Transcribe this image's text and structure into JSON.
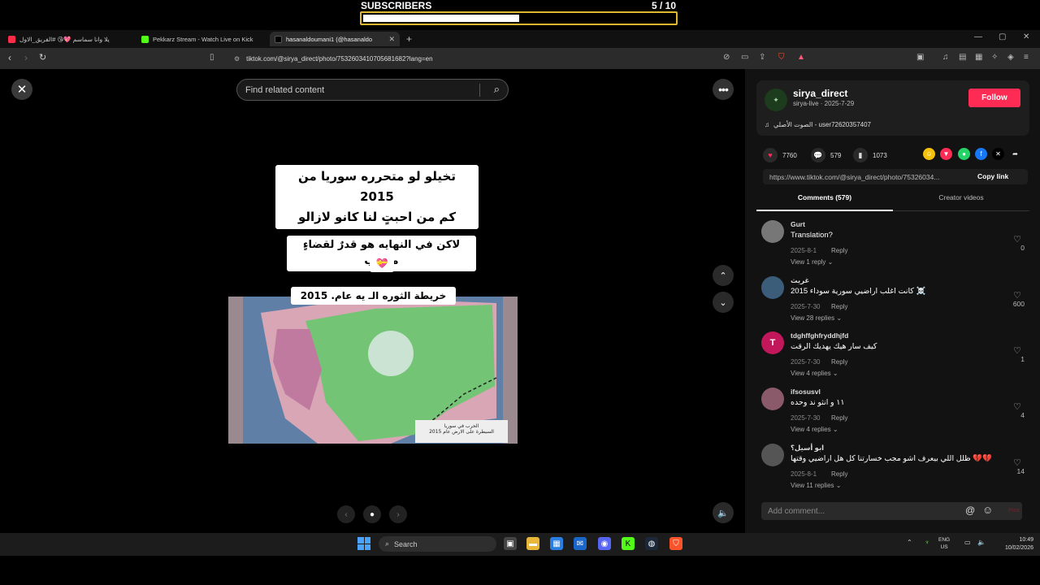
{
  "overlay": {
    "label": "SUBSCRIBERS",
    "count": "5  / 10",
    "progress": 0.5
  },
  "browser": {
    "tabs": [
      {
        "label": "يلا وانا سماسم 💖😘 #الفريق_الاول",
        "color": "#ff2b4a"
      },
      {
        "label": "Pekkarz Stream - Watch Live on Kick",
        "color": "#53fc18"
      },
      {
        "label": "hasanaldoumani1 (@hasanaldo",
        "color": "#222222"
      }
    ],
    "url": "tiktok.com/@sirya_direct/photo/7532603410705681682?lang=en"
  },
  "viewer": {
    "search_placeholder": "Find related content",
    "caption1_line1": "تخيلو لو متحرره سوريا من 2015",
    "caption1_line2": "كم من احبتٍ لنا كانو لازالو",
    "caption2": "لاكن في النهايه هو قدرٌ لقضاءٍ مكتوب",
    "caption2_emoji": "💝",
    "map_caption": "خريطة الثوره الـ   يه عام. 2015",
    "map_legend_line1": "الحرب في سوريا",
    "map_legend_line2": "السيطرة على الارض عام 2015"
  },
  "post": {
    "username": "sirya_direct",
    "meta": "sirya-live · 2025-7-29",
    "follow_label": "Follow",
    "music": "الصوت الأصلي - user72620357407",
    "likes": "7760",
    "comments": "579",
    "saves": "1073",
    "link": "https://www.tiktok.com/@sirya_direct/photo/75326034...",
    "copy_label": "Copy link",
    "tab_comments": "Comments (579)",
    "tab_creator": "Creator videos"
  },
  "comments": [
    {
      "user": "Gurt",
      "text": "Translation?",
      "date": "2025-8-1",
      "reply": "Reply",
      "view": "View 1 reply ⌄",
      "likes": "0",
      "avatar_color": "#777777"
    },
    {
      "user": "غريث",
      "text": "2015 كانت اغلب اراضيي سورية سوداء ☠️",
      "date": "2025-7-30",
      "reply": "Reply",
      "view": "View 28 replies ⌄",
      "likes": "600",
      "avatar_color": "#3b5d7a"
    },
    {
      "user": "tdghffghfryddhjfd",
      "text": "كيف سار هيك يهديك الرقت",
      "date": "2025-7-30",
      "reply": "Reply",
      "view": "View 4 replies ⌄",
      "likes": "1",
      "avatar_color": "#c2185b",
      "avatar_letter": "T"
    },
    {
      "user": "ifsosusvl",
      "text": "١١ و انثو ند وحده",
      "date": "2025-7-30",
      "reply": "Reply",
      "view": "View 4 replies ⌄",
      "likes": "4",
      "avatar_color": "#8a5a6a"
    },
    {
      "user": "ابو أسيل؟",
      "text": "ظلل اللي بيعرف اشو مجب خسارتنا كل هل اراضيي وقتها 💔💔",
      "date": "2025-8-1",
      "reply": "Reply",
      "view": "View 11 replies ⌄",
      "likes": "14",
      "avatar_color": "#555555"
    }
  ],
  "composer": {
    "placeholder": "Add comment...",
    "post_label": "Post"
  },
  "taskbar": {
    "search_label": "Search",
    "lang_line1": "ENG",
    "lang_line2": "US",
    "time": "10:49",
    "date": "10/02/2026"
  }
}
